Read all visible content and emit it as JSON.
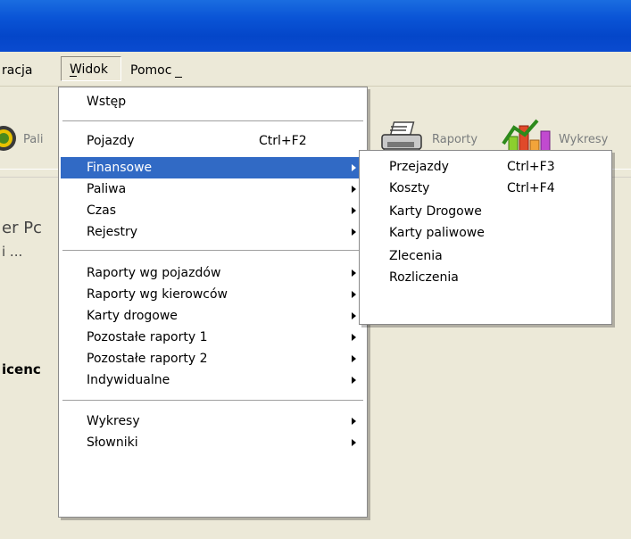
{
  "menubar": {
    "items": [
      {
        "label": "racja"
      },
      {
        "label": "Widok"
      },
      {
        "label": "Pomoc"
      }
    ]
  },
  "toolbar": {
    "buttons": [
      {
        "label": "Pali",
        "icon": "fuel-icon"
      },
      {
        "label": "Raporty",
        "icon": "printer-icon"
      },
      {
        "label": "Wykresy",
        "icon": "chart-icon"
      }
    ]
  },
  "main": {
    "text1": "er Pc",
    "text2": "i ...",
    "text3": "icenc"
  },
  "widok_menu": {
    "items": [
      {
        "label": "Wstęp",
        "shortcut": "",
        "submenu": false
      },
      {
        "label": "Pojazdy",
        "shortcut": "Ctrl+F2",
        "submenu": false
      },
      {
        "label": "Finansowe",
        "shortcut": "",
        "submenu": true,
        "highlighted": true
      },
      {
        "label": "Paliwa",
        "shortcut": "",
        "submenu": true
      },
      {
        "label": "Czas",
        "shortcut": "",
        "submenu": true
      },
      {
        "label": "Rejestry",
        "shortcut": "",
        "submenu": true
      },
      {
        "label": "Raporty wg pojazdów",
        "shortcut": "",
        "submenu": true
      },
      {
        "label": "Raporty wg kierowców",
        "shortcut": "",
        "submenu": true
      },
      {
        "label": "Karty drogowe",
        "shortcut": "",
        "submenu": true
      },
      {
        "label": "Pozostałe raporty 1",
        "shortcut": "",
        "submenu": true
      },
      {
        "label": "Pozostałe raporty 2",
        "shortcut": "",
        "submenu": true
      },
      {
        "label": "Indywidualne",
        "shortcut": "",
        "submenu": true
      },
      {
        "label": "Wykresy",
        "shortcut": "",
        "submenu": true
      },
      {
        "label": "Słowniki",
        "shortcut": "",
        "submenu": true
      }
    ]
  },
  "finansowe_menu": {
    "items": [
      {
        "label": "Przejazdy",
        "shortcut": "Ctrl+F3"
      },
      {
        "label": "Koszty",
        "shortcut": "Ctrl+F4"
      },
      {
        "label": "Karty Drogowe",
        "shortcut": ""
      },
      {
        "label": "Karty paliwowe",
        "shortcut": ""
      },
      {
        "label": "Zlecenia",
        "shortcut": ""
      },
      {
        "label": "Rozliczenia",
        "shortcut": ""
      }
    ]
  },
  "colors": {
    "titlebar": "#0a54d6",
    "highlight": "#316ac5",
    "face": "#ece9d8"
  }
}
